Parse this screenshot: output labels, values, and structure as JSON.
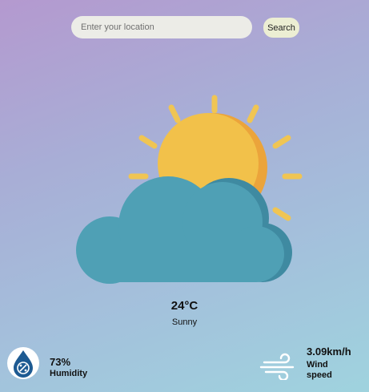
{
  "search": {
    "placeholder": "Enter your location",
    "value": "",
    "button_label": "Search"
  },
  "weather": {
    "temperature": "24°C",
    "condition": "Sunny",
    "icon": "sun-behind-cloud-icon"
  },
  "humidity": {
    "value": "73%",
    "label": "Humidity",
    "icon": "humidity-drop-icon"
  },
  "wind": {
    "value": "3.09km/h",
    "label": "Wind speed",
    "icon": "wind-icon"
  },
  "colors": {
    "sun": "#f2c14a",
    "sun_shade": "#eba43b",
    "cloud": "#4fa0b5",
    "cloud_shade": "#3f8aa1",
    "humidity_icon": "#1d5a92"
  }
}
